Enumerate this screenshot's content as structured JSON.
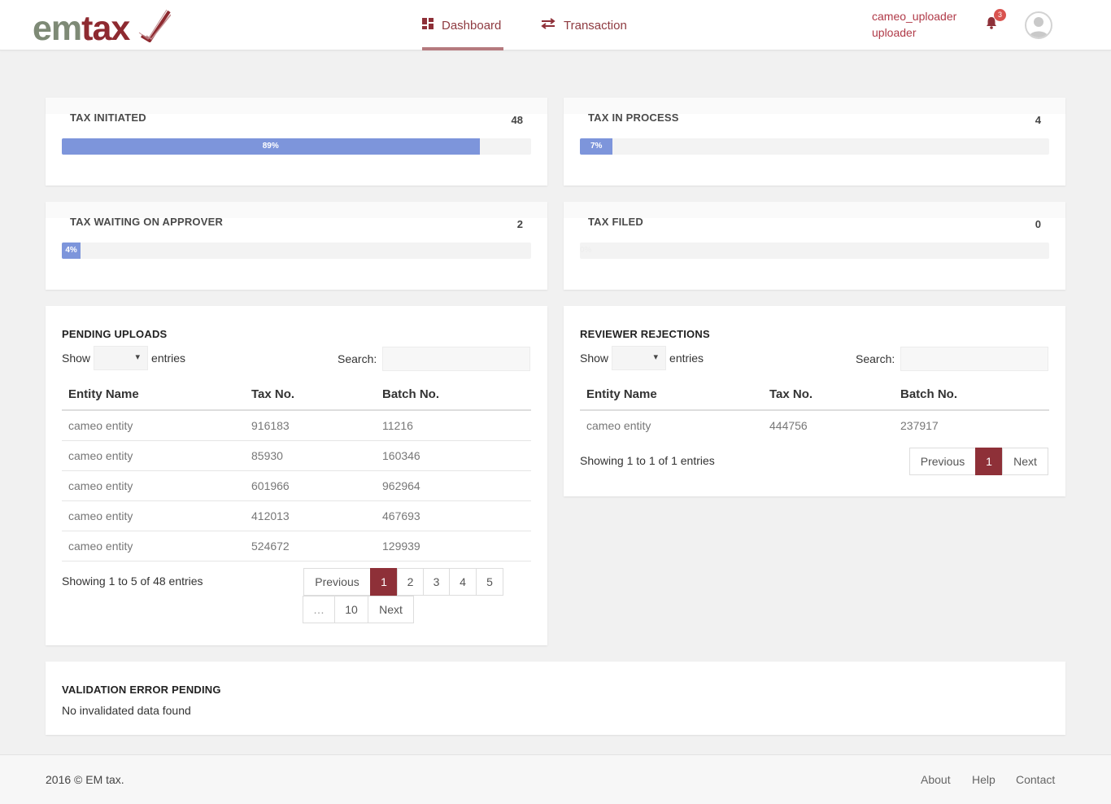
{
  "header": {
    "logo": "emtax",
    "nav": [
      {
        "label": "Dashboard",
        "icon": "dashboard-icon"
      },
      {
        "label": "Transaction",
        "icon": "transfer-arrows-icon"
      }
    ],
    "user": {
      "name": "cameo_uploader",
      "role": "uploader"
    },
    "notifications": "3",
    "colors": {
      "accent": "#8e3038",
      "nav_text": "#8e3a40",
      "progress": "#7d95db"
    }
  },
  "stats": [
    {
      "title": "TAX INITIATED",
      "count": "48",
      "percent": 89,
      "percent_label": "89%"
    },
    {
      "title": "TAX IN PROCESS",
      "count": "4",
      "percent": 7,
      "percent_label": "7%"
    },
    {
      "title": "TAX WAITING ON APPROVER",
      "count": "2",
      "percent": 4,
      "percent_label": "4%"
    },
    {
      "title": "TAX FILED",
      "count": "0",
      "percent": 0,
      "percent_label": "0%"
    }
  ],
  "pending": {
    "title": "PENDING UPLOADS",
    "show": "Show",
    "entries": "entries",
    "search": "Search:",
    "columns": [
      "Entity Name",
      "Tax No.",
      "Batch No."
    ],
    "rows": [
      [
        "cameo entity",
        "916183",
        "11216"
      ],
      [
        "cameo entity",
        "85930",
        "160346"
      ],
      [
        "cameo entity",
        "601966",
        "962964"
      ],
      [
        "cameo entity",
        "412013",
        "467693"
      ],
      [
        "cameo entity",
        "524672",
        "129939"
      ]
    ],
    "info": "Showing 1 to 5 of 48 entries",
    "pager": {
      "prev": "Previous",
      "pages": [
        "1",
        "2",
        "3",
        "4",
        "5"
      ],
      "ellipsis": "…",
      "last": "10",
      "next": "Next"
    }
  },
  "rejections": {
    "title": "REVIEWER REJECTIONS",
    "show": "Show",
    "entries": "entries",
    "search": "Search:",
    "columns": [
      "Entity Name",
      "Tax No.",
      "Batch No."
    ],
    "rows": [
      [
        "cameo entity",
        "444756",
        "237917"
      ]
    ],
    "info": "Showing 1 to 1 of 1 entries",
    "pager": {
      "prev": "Previous",
      "page": "1",
      "next": "Next"
    }
  },
  "validation": {
    "title": "VALIDATION ERROR PENDING",
    "message": "No invalidated data found"
  },
  "footer": {
    "copyright": "2016 © EM tax.",
    "links": [
      "About",
      "Help",
      "Contact"
    ]
  }
}
